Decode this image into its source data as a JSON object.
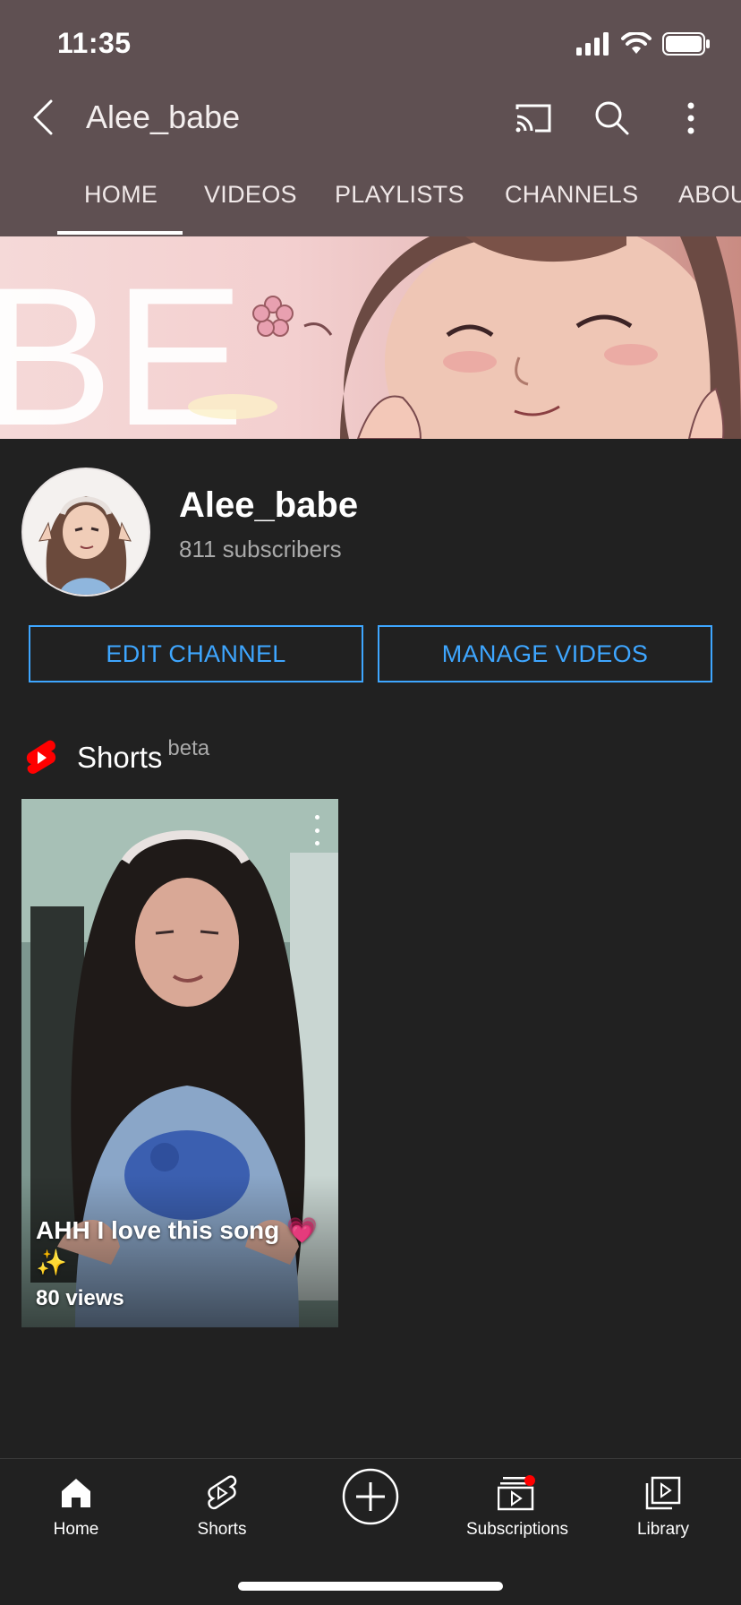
{
  "status_bar": {
    "time": "11:35"
  },
  "header": {
    "title": "Alee_babe"
  },
  "tabs": [
    {
      "label": "HOME",
      "active": true
    },
    {
      "label": "VIDEOS"
    },
    {
      "label": "PLAYLISTS"
    },
    {
      "label": "CHANNELS"
    },
    {
      "label": "ABOU"
    }
  ],
  "banner": {
    "text": "BE"
  },
  "channel": {
    "name": "Alee_babe",
    "subscribers": "811 subscribers"
  },
  "buttons": {
    "edit_channel": "EDIT CHANNEL",
    "manage_videos": "MANAGE VIDEOS"
  },
  "shorts": {
    "label": "Shorts",
    "badge": "beta",
    "items": [
      {
        "title": "AHH I love this song 💗 ✨",
        "views": "80 views"
      }
    ]
  },
  "bottom_nav": [
    {
      "label": "Home",
      "icon": "home-icon",
      "active": true
    },
    {
      "label": "Shorts",
      "icon": "shorts-icon"
    },
    {
      "label": "",
      "icon": "create-icon"
    },
    {
      "label": "Subscriptions",
      "icon": "subscriptions-icon",
      "badge_color": "#ff0000"
    },
    {
      "label": "Library",
      "icon": "library-icon"
    }
  ],
  "colors": {
    "header_bg": "#5f5052",
    "accent": "#3ea6ff",
    "bg": "#212121",
    "shorts_red": "#ff0000"
  }
}
